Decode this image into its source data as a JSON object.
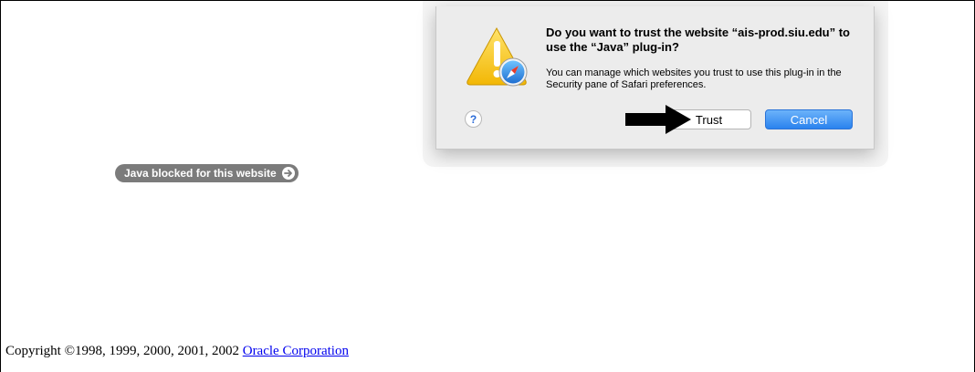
{
  "plugin_notice": {
    "label": "Java blocked for this website"
  },
  "trust_dialog": {
    "title": "Do you want to trust the website “ais-prod.siu.edu” to use the “Java” plug-in?",
    "body": "You can manage which websites you trust to use this plug-in in the Security pane of Safari preferences.",
    "help_label": "?",
    "trust_label": "Trust",
    "cancel_label": "Cancel",
    "accent_color": "#2a82ee"
  },
  "footer": {
    "copyright_text": "Copyright ©1998, 1999, 2000, 2001, 2002",
    "link_text": "Oracle Corporation"
  },
  "icons": {
    "warning": "warning-triangle-icon",
    "badge": "safari-compass-icon",
    "arrow": "arrow-right-circle-icon",
    "pointer": "black-arrow-pointer"
  }
}
